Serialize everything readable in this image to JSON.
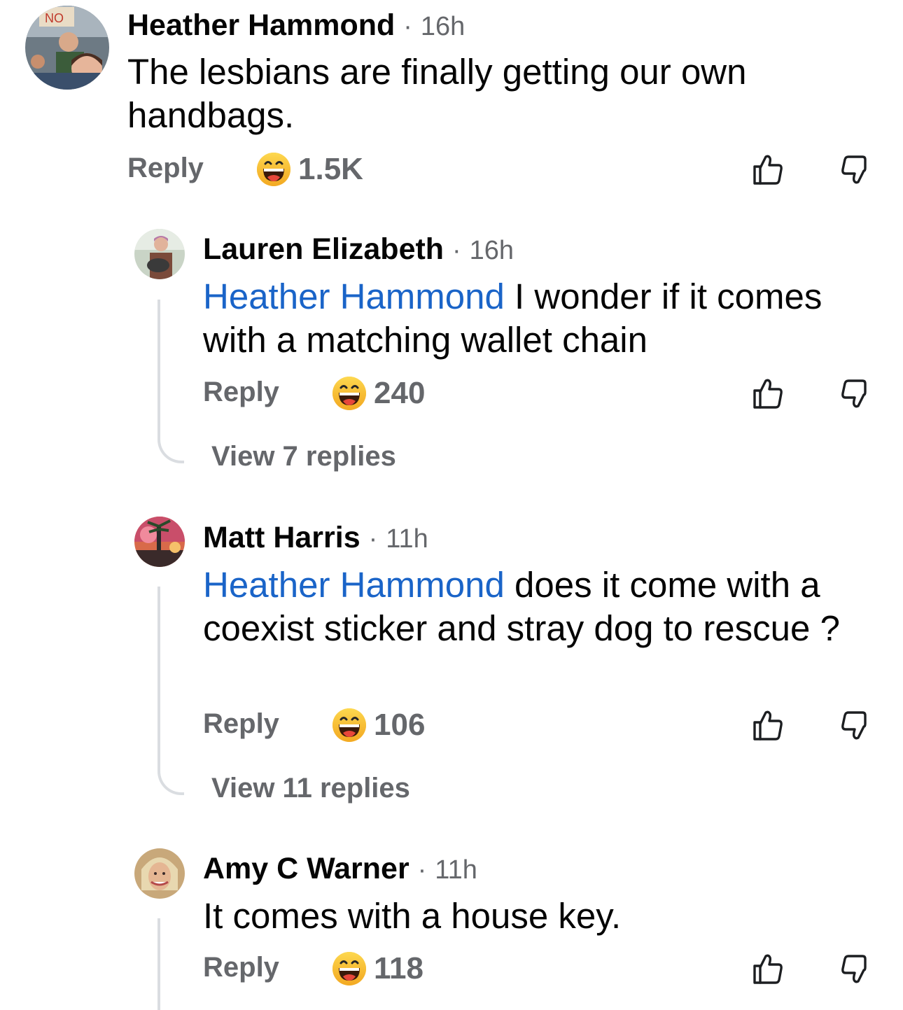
{
  "comments": [
    {
      "author": "Heather Hammond",
      "separator": "·",
      "time": "16h",
      "mention": "",
      "text": "The lesbians are finally getting our own handbags.",
      "reply_label": "Reply",
      "reaction_icon": "laughing-emoji",
      "reaction_count": "1.5K"
    },
    {
      "author": "Lauren Elizabeth",
      "separator": "·",
      "time": "16h",
      "mention": "Heather Hammond",
      "text": "I wonder if it comes with a matching wallet chain",
      "reply_label": "Reply",
      "reaction_icon": "laughing-emoji",
      "reaction_count": "240",
      "view_replies": "View 7 replies"
    },
    {
      "author": "Matt Harris",
      "separator": "·",
      "time": "11h",
      "mention": "Heather Hammond",
      "text": "does it come with a coexist sticker and stray dog to rescue ?",
      "reply_label": "Reply",
      "reaction_icon": "laughing-emoji",
      "reaction_count": "106",
      "view_replies": "View 11 replies"
    },
    {
      "author": "Amy C Warner",
      "separator": "·",
      "time": "11h",
      "mention": "",
      "text": "It comes with a house key.",
      "reply_label": "Reply",
      "reaction_icon": "laughing-emoji",
      "reaction_count": "118"
    }
  ],
  "colors": {
    "mention": "#1a64c8",
    "secondary_text": "#65676b",
    "thread_line": "#dadde1"
  }
}
